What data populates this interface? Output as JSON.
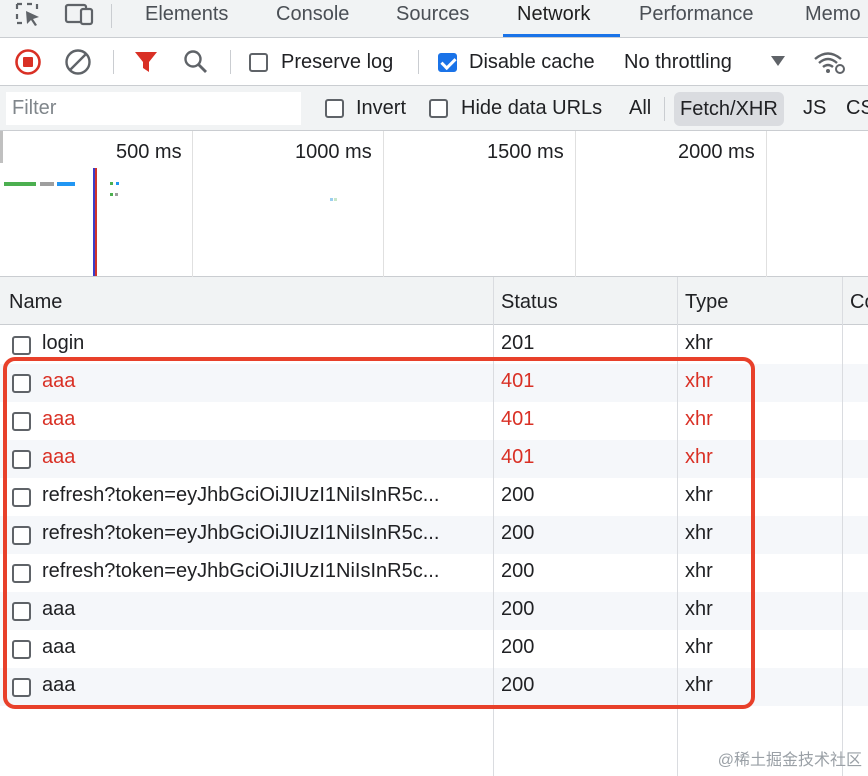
{
  "tabs": [
    {
      "label": "Elements"
    },
    {
      "label": "Console"
    },
    {
      "label": "Sources"
    },
    {
      "label": "Network"
    },
    {
      "label": "Performance"
    },
    {
      "label": "Memo"
    }
  ],
  "toolbar": {
    "preserve_log": "Preserve log",
    "disable_cache": "Disable cache",
    "throttling": "No throttling"
  },
  "filter": {
    "placeholder": "Filter",
    "invert": "Invert",
    "hide_data_urls": "Hide data URLs",
    "types": [
      "All",
      "Fetch/XHR",
      "JS",
      "CS"
    ]
  },
  "overview": {
    "ticks": [
      "500 ms",
      "1000 ms",
      "1500 ms",
      "2000 ms"
    ]
  },
  "table": {
    "columns": [
      "Name",
      "Status",
      "Type",
      "Co"
    ],
    "rows": [
      {
        "name": "login",
        "status": "201",
        "type": "xhr"
      },
      {
        "name": "aaa",
        "status": "401",
        "type": "xhr"
      },
      {
        "name": "aaa",
        "status": "401",
        "type": "xhr"
      },
      {
        "name": "aaa",
        "status": "401",
        "type": "xhr"
      },
      {
        "name": "refresh?token=eyJhbGciOiJIUzI1NiIsInR5c...",
        "status": "200",
        "type": "xhr"
      },
      {
        "name": "refresh?token=eyJhbGciOiJIUzI1NiIsInR5c...",
        "status": "200",
        "type": "xhr"
      },
      {
        "name": "refresh?token=eyJhbGciOiJIUzI1NiIsInR5c...",
        "status": "200",
        "type": "xhr"
      },
      {
        "name": "aaa",
        "status": "200",
        "type": "xhr"
      },
      {
        "name": "aaa",
        "status": "200",
        "type": "xhr"
      },
      {
        "name": "aaa",
        "status": "200",
        "type": "xhr"
      }
    ]
  },
  "watermark": "@稀土掘金技术社区",
  "colors": {
    "accent": "#1a73e8",
    "record": "#d93025",
    "error_text": "#d93025",
    "highlight": "#e8402a"
  },
  "icons": [
    "inspect-icon",
    "device-toggle-icon",
    "record-stop-icon",
    "clear-icon",
    "filter-icon",
    "search-icon",
    "wifi-settings-icon"
  ]
}
